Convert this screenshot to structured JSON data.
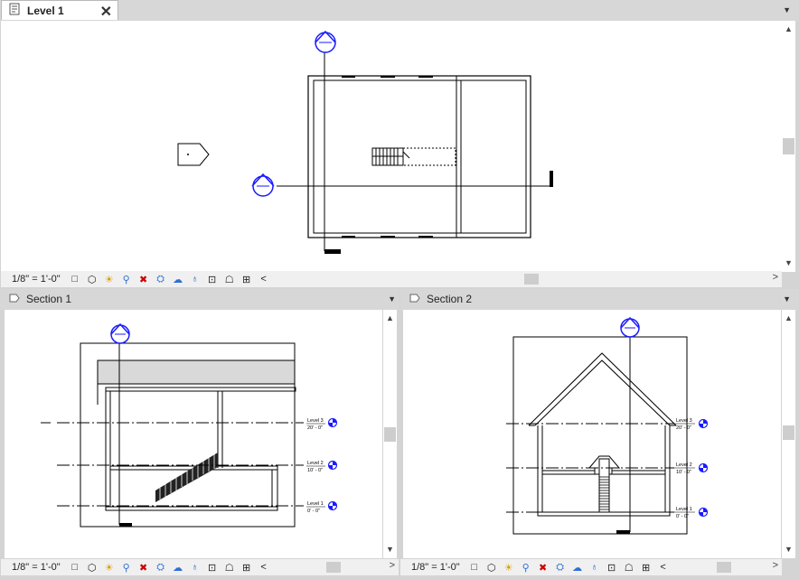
{
  "views": {
    "level1": {
      "title": "Level 1",
      "close": "✕",
      "scale": "1/8\" = 1'-0\""
    },
    "section1": {
      "title": "Section 1",
      "scale": "1/8\" = 1'-0\""
    },
    "section2": {
      "title": "Section 2",
      "scale": "1/8\" = 1'-0\""
    }
  },
  "levels": {
    "level3": {
      "name": "Level 3",
      "elev": "20' - 0\""
    },
    "level2": {
      "name": "Level 2",
      "elev": "10' - 0\""
    },
    "level1": {
      "name": "Level 1",
      "elev": "0' - 0\""
    }
  },
  "icons": {
    "menu": "▼",
    "up": "▲",
    "down": "▼",
    "left": "<",
    "right": ">",
    "status": [
      "□",
      "⬡",
      "☀",
      "⚲",
      "✖",
      "⛭",
      "☁",
      "♁",
      "⊡",
      "☖",
      "⊞"
    ]
  },
  "colors": {
    "marker_blue": "#1a1aff",
    "accent": "#2f6fd6"
  }
}
